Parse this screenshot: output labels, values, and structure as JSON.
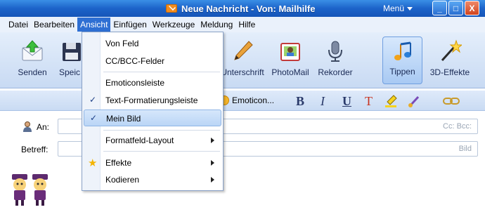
{
  "window": {
    "title": "Neue Nachricht - Von: Mailhilfe",
    "menu_label": "Menü",
    "btn_minimize": "_",
    "btn_maximize": "□",
    "btn_close": "X"
  },
  "menubar": [
    "Datei",
    "Bearbeiten",
    "Ansicht",
    "Einfügen",
    "Werkzeuge",
    "Meldung",
    "Hilfe"
  ],
  "toolbar": {
    "senden": "Senden",
    "speichern": "Speic",
    "unterschrift": "Unterschrift",
    "photomail": "PhotoMail",
    "rekorder": "Rekorder",
    "tippen": "Tippen",
    "effekte": "3D-Effekte"
  },
  "formatbar": {
    "emoticons": "Emoticon...",
    "bold": "B",
    "italic": "I",
    "underline": "U",
    "textcolor": "T"
  },
  "fields": {
    "to_label": "An:",
    "to_hint": "Cc: Bcc:",
    "subject_label": "Betreff:",
    "subject_hint": "Bild"
  },
  "dropdown": {
    "von_feld": "Von Feld",
    "cc_bcc": "CC/BCC-Felder",
    "emoticonleiste": "Emoticonsleiste",
    "textformat": "Text-Formatierungsleiste",
    "mein_bild": "Mein Bild",
    "formatfeld": "Formatfeld-Layout",
    "effekte": "Effekte",
    "kodieren": "Kodieren",
    "check": "✓"
  },
  "colors": {
    "titlebar": "#1c63c9",
    "menu_active": "#2e6fd3",
    "toolbar": "#c8daf3"
  }
}
